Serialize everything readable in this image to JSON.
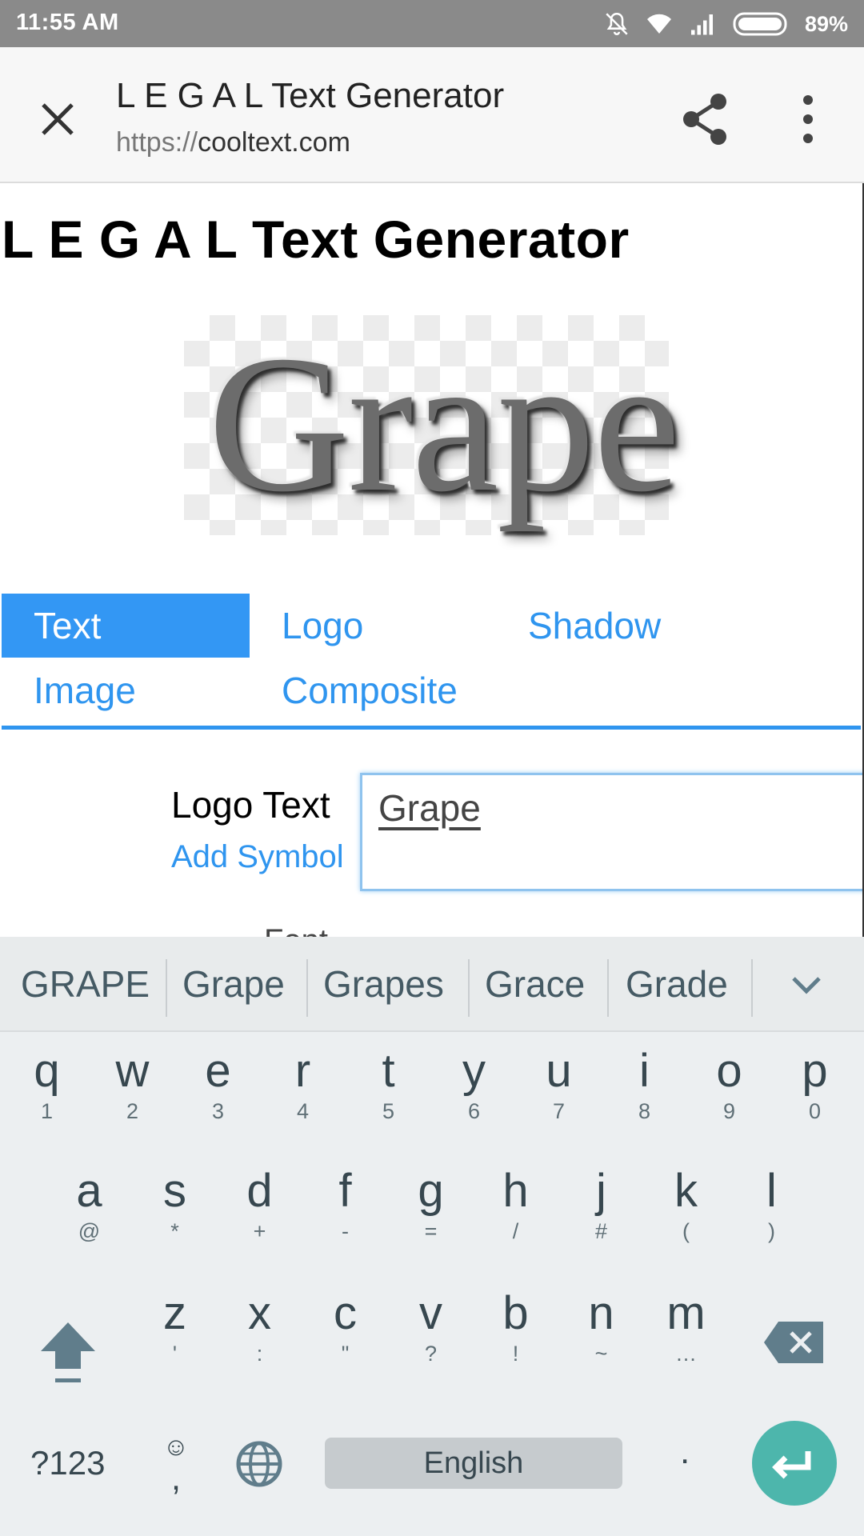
{
  "status_bar": {
    "time": "11:55 AM",
    "battery_percent": "89%",
    "icons": [
      "bell-off-icon",
      "wifi-icon",
      "signal-icon",
      "battery-icon"
    ]
  },
  "browser": {
    "title": "L E G A L Text Generator",
    "url_scheme": "https://",
    "url_host": "cooltext.com",
    "icons": [
      "close-icon",
      "share-icon",
      "more-vert-icon"
    ]
  },
  "page": {
    "heading": "L E G A L Text Generator",
    "preview_text": "Grape",
    "tabs": [
      {
        "label": "Text",
        "active": true
      },
      {
        "label": "Logo",
        "active": false
      },
      {
        "label": "Shadow",
        "active": false
      },
      {
        "label": "Image",
        "active": false
      },
      {
        "label": "Composite",
        "active": false
      }
    ],
    "form": {
      "logo_text_label": "Logo Text",
      "add_symbol_label": "Add Symbol",
      "logo_text_value": "Grape",
      "next_row_partial": "Font"
    },
    "accent_color": "#3397f4"
  },
  "keyboard": {
    "suggestions": [
      "GRAPE",
      "Grape",
      "Grapes",
      "Grace",
      "Grade"
    ],
    "row1": [
      {
        "m": "q",
        "s": "1"
      },
      {
        "m": "w",
        "s": "2"
      },
      {
        "m": "e",
        "s": "3"
      },
      {
        "m": "r",
        "s": "4"
      },
      {
        "m": "t",
        "s": "5"
      },
      {
        "m": "y",
        "s": "6"
      },
      {
        "m": "u",
        "s": "7"
      },
      {
        "m": "i",
        "s": "8"
      },
      {
        "m": "o",
        "s": "9"
      },
      {
        "m": "p",
        "s": "0"
      }
    ],
    "row2": [
      {
        "m": "a",
        "s": "@"
      },
      {
        "m": "s",
        "s": "*"
      },
      {
        "m": "d",
        "s": "+"
      },
      {
        "m": "f",
        "s": "-"
      },
      {
        "m": "g",
        "s": "="
      },
      {
        "m": "h",
        "s": "/"
      },
      {
        "m": "j",
        "s": "#"
      },
      {
        "m": "k",
        "s": "("
      },
      {
        "m": "l",
        "s": ")"
      }
    ],
    "row3": [
      {
        "m": "z",
        "s": "'"
      },
      {
        "m": "x",
        "s": ":"
      },
      {
        "m": "c",
        "s": "\""
      },
      {
        "m": "v",
        "s": "?"
      },
      {
        "m": "b",
        "s": "!"
      },
      {
        "m": "n",
        "s": "~"
      },
      {
        "m": "m",
        "s": "…"
      }
    ],
    "symbols_key": "?123",
    "comma_key": ",",
    "emoji_hint": "☺",
    "space_label": "English",
    "period_key": ".",
    "enter_color": "#4db6ac"
  }
}
